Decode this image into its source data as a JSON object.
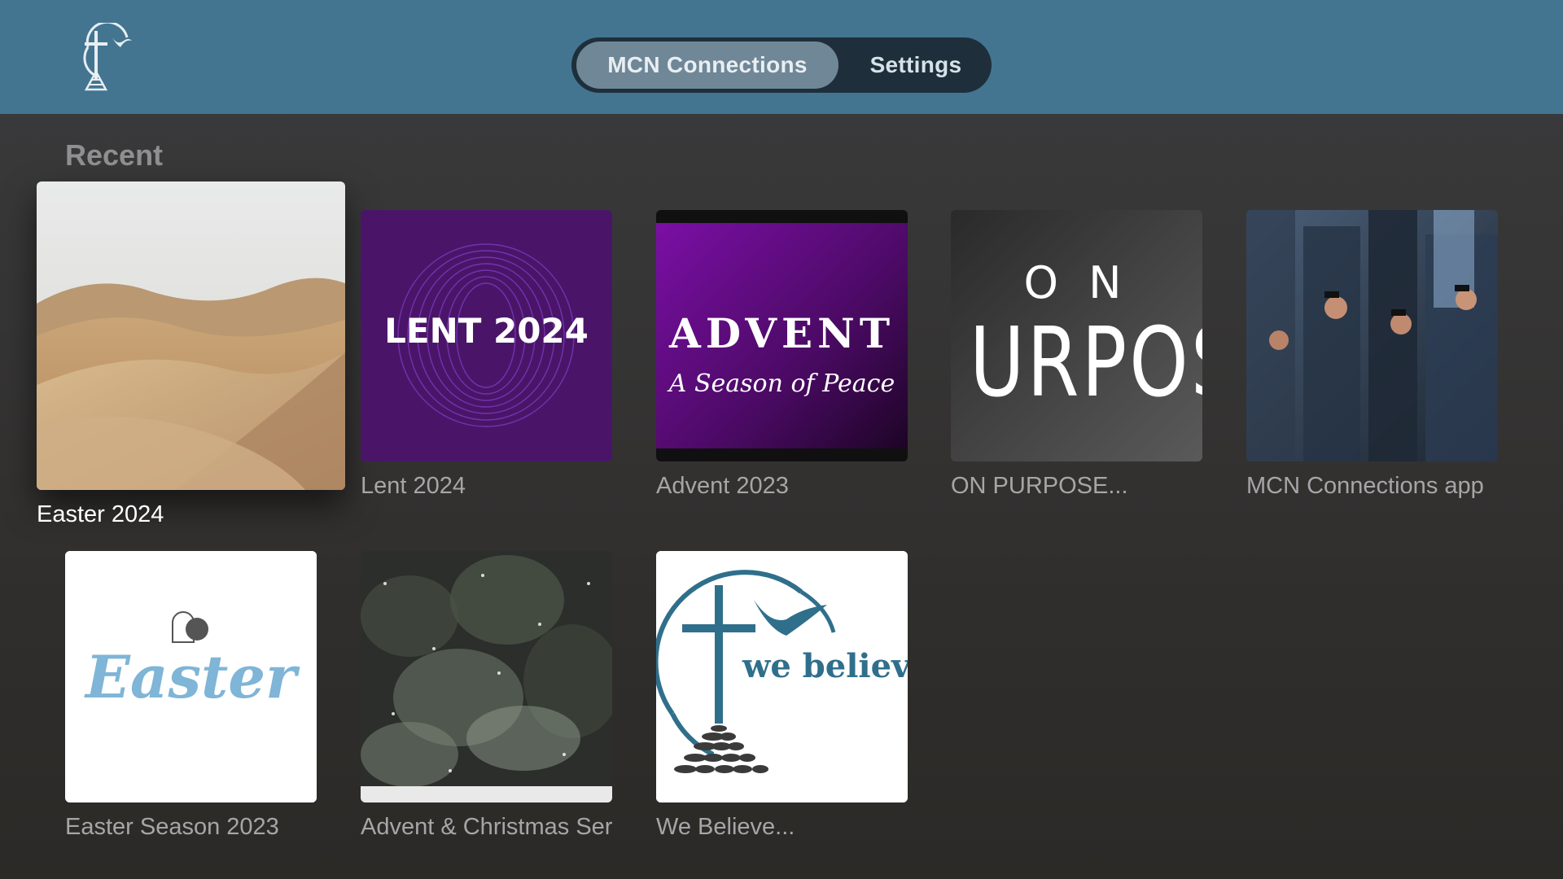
{
  "header": {
    "logo_icon": "cross-dove-logo-icon",
    "tabs": [
      {
        "label": "MCN Connections",
        "active": true
      },
      {
        "label": "Settings",
        "active": false
      }
    ]
  },
  "section": {
    "title": "Recent"
  },
  "tiles": [
    {
      "title": "Easter 2024",
      "art": "desert-dunes",
      "focused": true
    },
    {
      "title": "Lent 2024",
      "art_text": "LENT 2024"
    },
    {
      "title": "Advent 2023",
      "art_text": "ADVENT",
      "art_subtext": "A Season of Peace"
    },
    {
      "title": "ON PURPOSE...",
      "art_text_top": "O N",
      "art_text": "URPOS"
    },
    {
      "title": "MCN Connections app",
      "art": "people-with-phones"
    },
    {
      "title": "Easter Season 2023",
      "art_text": "Easter"
    },
    {
      "title": "Advent & Christmas Series",
      "art": "snowy-trees"
    },
    {
      "title": "We Believe...",
      "art_text": "we believe"
    }
  ]
}
